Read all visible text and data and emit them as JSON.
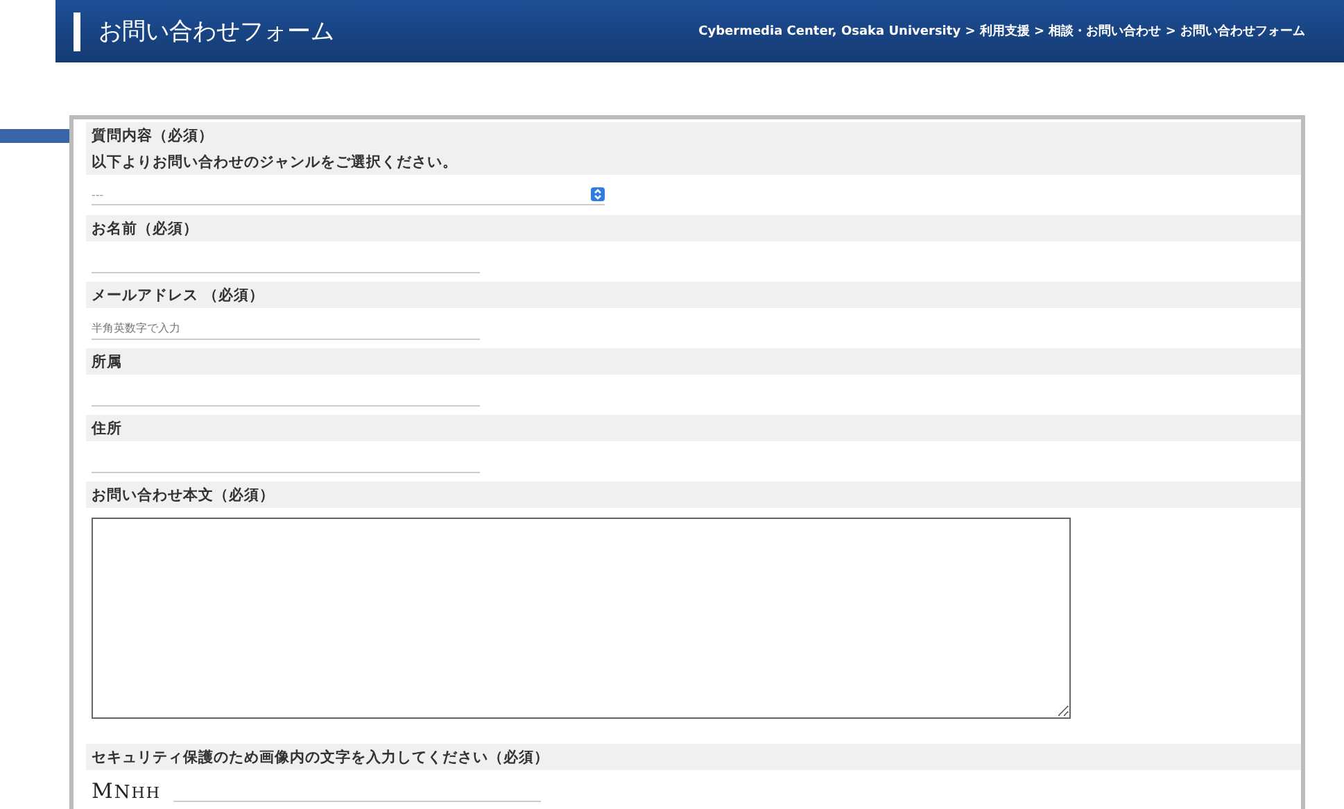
{
  "header": {
    "title": "お問い合わせフォーム",
    "breadcrumb": "Cybermedia Center, Osaka University > 利用支援 > 相談・お問い合わせ > お問い合わせフォーム"
  },
  "fields": [
    {
      "kind": "select",
      "label": "質問内容（必須）",
      "note": "以下よりお問い合わせのジャンルをご選択ください。",
      "value": "---"
    },
    {
      "kind": "text",
      "label": "お名前（必須）"
    },
    {
      "kind": "text",
      "label": "メールアドレス （必須）",
      "placeholder": "半角英数字で入力"
    },
    {
      "kind": "text",
      "label": "所属"
    },
    {
      "kind": "text",
      "label": "住所"
    },
    {
      "kind": "textarea",
      "label": "お問い合わせ本文（必須）"
    },
    {
      "kind": "captcha",
      "label": "セキュリティ保護のため画像内の文字を入力してください（必須）",
      "captcha": "MNHH"
    }
  ]
}
